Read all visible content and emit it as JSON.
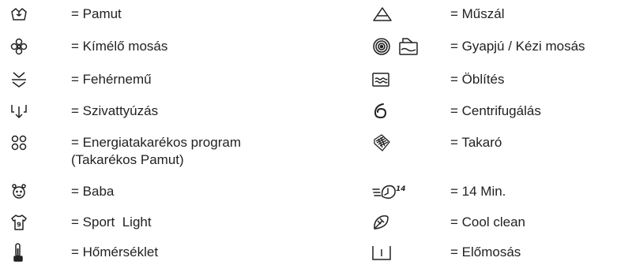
{
  "left": [
    {
      "icon": "cotton-icon",
      "label": "= Pamut"
    },
    {
      "icon": "delicate-wash-icon",
      "label": "= Kímélő mosás"
    },
    {
      "icon": "underwear-icon",
      "label": "= Fehérnemű"
    },
    {
      "icon": "drain-pump-icon",
      "label": "= Szivattyúzás"
    },
    {
      "icon": "eco-program-icon",
      "label": "= Energiatakarékos program",
      "label2": "(Takarékos Pamut)"
    },
    {
      "icon": "baby-icon",
      "label": "= Baba"
    },
    {
      "icon": "sport-shirt-icon",
      "label": "= Sport  Light"
    },
    {
      "icon": "thermometer-icon",
      "label": "= Hőmérséklet"
    }
  ],
  "right": [
    {
      "icon": "synthetic-icon",
      "label": "= Műszál"
    },
    {
      "icon": "wool-handwash-icon",
      "label": "= Gyapjú / Kézi mosás"
    },
    {
      "icon": "rinse-icon",
      "label": "= Öblítés"
    },
    {
      "icon": "spin-icon",
      "label": "= Centrifugálás"
    },
    {
      "icon": "duvet-icon",
      "label": "= Takaró"
    },
    {
      "icon": "quick-14-min-icon",
      "label": "= 14 Min.",
      "icon_text": "14'"
    },
    {
      "icon": "cool-clean-leaf-icon",
      "label": "= Cool clean"
    },
    {
      "icon": "prewash-icon",
      "label": "= Előmosás"
    }
  ]
}
